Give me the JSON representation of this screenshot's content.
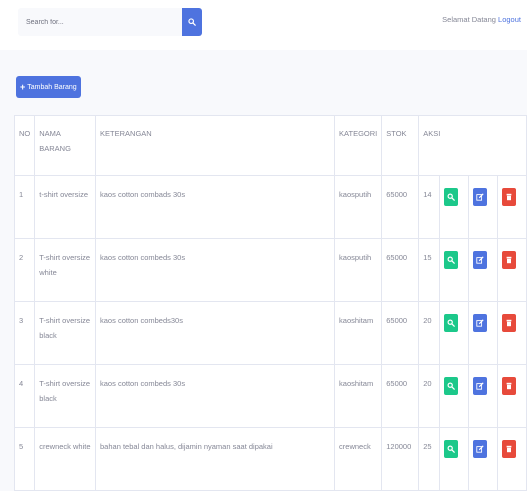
{
  "search": {
    "placeholder": "Search for..."
  },
  "header": {
    "greeting": "Selamat Datang",
    "logout": "Logout"
  },
  "toolbar": {
    "add_label": "Tambah Barang"
  },
  "table": {
    "headers": [
      "NO",
      "NAMA BARANG",
      "KETERANGAN",
      "KATEGORI",
      "STOK",
      "AKSI"
    ],
    "rows": [
      {
        "no": "1",
        "nama": "t-shirt oversize",
        "keterangan": "kaos cotton combads 30s",
        "kategori": "kaosputih",
        "stok": "65000",
        "jumlah": "14"
      },
      {
        "no": "2",
        "nama": "T-shirt oversize white",
        "keterangan": "kaos cotton combeds 30s",
        "kategori": "kaosputih",
        "stok": "65000",
        "jumlah": "15"
      },
      {
        "no": "3",
        "nama": "T-shirt oversize black",
        "keterangan": "kaos cotton combeds30s",
        "kategori": "kaoshitam",
        "stok": "65000",
        "jumlah": "20"
      },
      {
        "no": "4",
        "nama": "T-shirt oversize black",
        "keterangan": "kaos cotton combeds 30s",
        "kategori": "kaoshitam",
        "stok": "65000",
        "jumlah": "20"
      },
      {
        "no": "5",
        "nama": "crewneck white",
        "keterangan": "bahan tebal dan halus, dijamin nyaman saat dipakai",
        "kategori": "crewneck",
        "stok": "120000",
        "jumlah": "25"
      }
    ]
  },
  "icons": {
    "search": "search-icon",
    "view": "search-icon",
    "edit": "edit-icon",
    "delete": "trash-icon"
  },
  "colors": {
    "primary": "#4e73df",
    "success": "#1cc88a",
    "danger": "#e74a3b",
    "text": "#858796",
    "background": "#f8f9fc"
  }
}
